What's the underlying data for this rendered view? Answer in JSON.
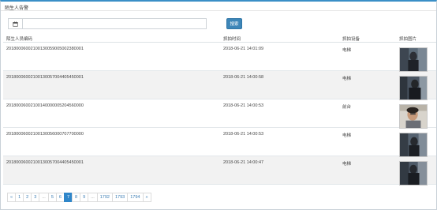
{
  "panel": {
    "title": "陌生人告警"
  },
  "filter": {
    "date_value": "",
    "search_label": "搜索"
  },
  "table": {
    "headers": [
      "陌生人员编码",
      "抓拍时间",
      "抓拍设备",
      "抓拍图片"
    ],
    "rows": [
      {
        "code": "20180006002100130059005002380001",
        "time": "2018-06-21 14:01:09",
        "device": "电梯"
      },
      {
        "code": "20180006002100130057004405450001",
        "time": "2018-06-21 14:00:58",
        "device": "电梯"
      },
      {
        "code": "20180006002100140000005204560000",
        "time": "2018-06-21 14:00:53",
        "device": "前台"
      },
      {
        "code": "20180006002100130056000707700000",
        "time": "2018-06-21 14:00:53",
        "device": "电梯"
      },
      {
        "code": "20180006002100130057004405450001",
        "time": "2018-06-21 14:00:47",
        "device": "电梯"
      }
    ]
  },
  "pagination": {
    "prev": "«",
    "next": "»",
    "pages": [
      "1",
      "2",
      "3",
      "...",
      "5",
      "6",
      "7",
      "8",
      "9",
      "...",
      "1792",
      "1793",
      "1794"
    ],
    "active": "7"
  },
  "colors": {
    "accent": "#2f86c9",
    "button": "#3d86b8",
    "row_alt": "#f2f2f2"
  },
  "icons": {
    "date": "calendar-icon"
  }
}
